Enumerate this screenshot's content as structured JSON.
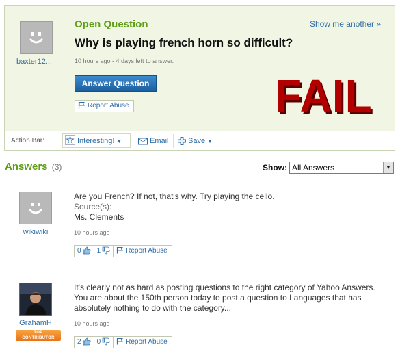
{
  "question": {
    "kind_label": "Open Question",
    "show_another": "Show me another »",
    "title": "Why is playing french horn so difficult?",
    "meta": "10 hours ago - 4 days left to answer.",
    "asker_name": "baxter12...",
    "answer_button": "Answer Question",
    "report_abuse": "Report Abuse",
    "overlay_text": "FAIL"
  },
  "action_bar": {
    "label": "Action Bar:",
    "interesting": "Interesting!",
    "email": "Email",
    "save": "Save"
  },
  "answers_header": {
    "title": "Answers",
    "count": "(3)",
    "show_label": "Show:",
    "show_selected": "All Answers"
  },
  "answers": [
    {
      "user": "wikiwiki",
      "text": "Are you French? If not, that's why. Try playing the cello.",
      "sources_label": "Source(s):",
      "source": "Ms. Clements",
      "time": "10 hours ago",
      "thumbs_up": "0",
      "thumbs_down": "1",
      "report_abuse": "Report Abuse"
    },
    {
      "user": "GrahamH",
      "badge_line1": "TOP",
      "badge_line2": "CONTRIBUTOR",
      "text": "It's clearly not as hard as posting questions to the right category of Yahoo Answers. You are about the 150th person today to post a question to Languages that has absolutely nothing to do with the category...",
      "time": "10 hours ago",
      "thumbs_up": "2",
      "thumbs_down": "0",
      "report_abuse": "Report Abuse"
    }
  ],
  "colors": {
    "accent_green": "#5e9e15",
    "link_blue": "#2f6ea7",
    "panel_bg": "#f1f6e4",
    "fail_red": "#b20000",
    "button_blue": "#1b5f9e",
    "badge_orange": "#e8741a"
  },
  "icons": [
    "default-avatar-icon",
    "flag-icon",
    "star-icon",
    "envelope-icon",
    "plus-icon",
    "thumbs-up-icon",
    "thumbs-down-icon",
    "dropdown-arrow-icon"
  ]
}
